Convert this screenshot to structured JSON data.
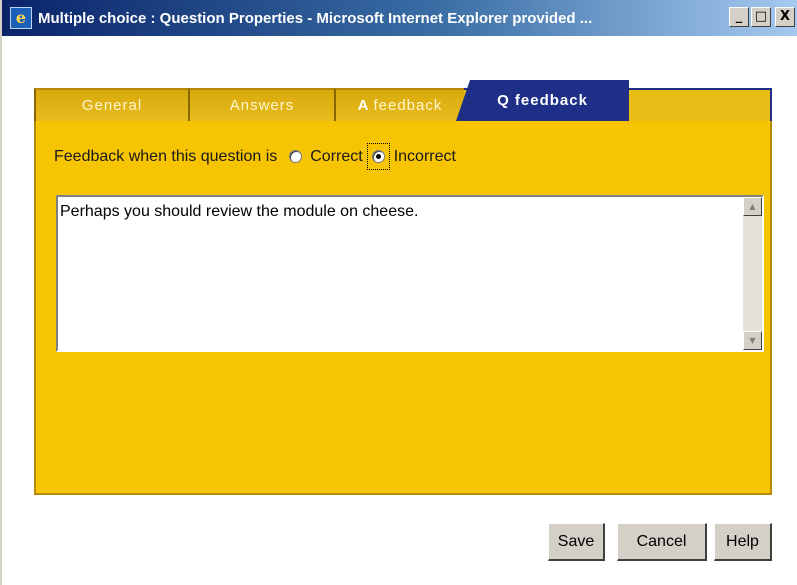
{
  "window": {
    "title": "Multiple choice : Question Properties - Microsoft Internet Explorer provided ...",
    "minimize_glyph": "_",
    "maximize_glyph": "□",
    "close_glyph": "X"
  },
  "tabs": [
    {
      "label": "General",
      "active": false
    },
    {
      "label": "Answers",
      "active": false
    },
    {
      "prefix": "A",
      "label": "feedback",
      "active": false
    },
    {
      "label": "Q feedback",
      "active": true
    }
  ],
  "feedback": {
    "prompt": "Feedback when this question is",
    "options": [
      {
        "label": "Correct",
        "checked": false
      },
      {
        "label": "Incorrect",
        "checked": true
      }
    ],
    "text": "Perhaps you should review the module on cheese."
  },
  "buttons": {
    "save": "Save",
    "cancel": "Cancel",
    "help": "Help"
  },
  "colors": {
    "panel": "#f6c400",
    "active_tab": "#1f2f88",
    "inactive_tab": "#e0b315"
  },
  "icons": {
    "app": "ie-icon",
    "scroll_up": "scroll-up-arrow-icon",
    "scroll_down": "scroll-down-arrow-icon"
  }
}
